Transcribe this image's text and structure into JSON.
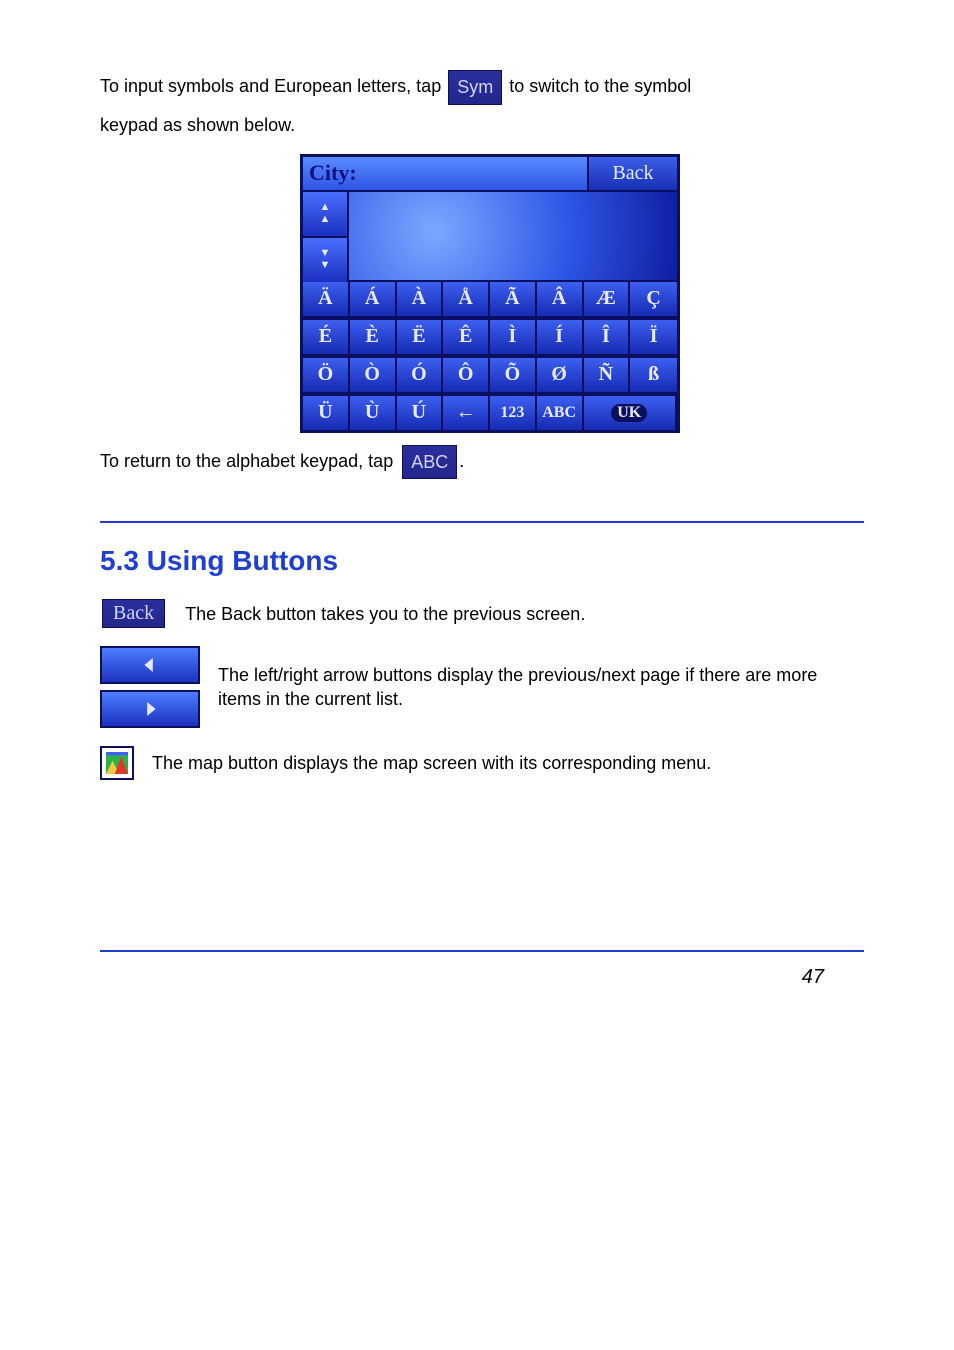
{
  "intro": {
    "p1_a": "To input symbols and European letters, tap",
    "p1_b": "to switch to the symbol",
    "p2": "keypad as shown below.",
    "sym_chip": "Sym",
    "p3_a": "To return to the alphabet keypad, tap",
    "p3_b": ".",
    "abc_chip": "ABC"
  },
  "keyboard": {
    "title": "City:",
    "back_label": "Back",
    "arrows_up_glyph": "▲▲",
    "arrows_dn_glyph": "▼▼",
    "rows": [
      [
        "Ä",
        "Á",
        "À",
        "Å",
        "Ã",
        "Â",
        "Æ",
        "Ç"
      ],
      [
        "É",
        "È",
        "Ë",
        "Ê",
        "Ì",
        "Í",
        "Î",
        "Ï"
      ],
      [
        "Ö",
        "Ò",
        "Ó",
        "Ô",
        "Õ",
        "Ø",
        "Ñ",
        "ß"
      ]
    ],
    "row4": {
      "k1": "Ü",
      "k2": "Ù",
      "k3": "Ú",
      "back_glyph": "←",
      "num": "123",
      "abc": "ABC",
      "lang": "UK"
    }
  },
  "section": {
    "heading": "5.3 Using Buttons",
    "back_row": {
      "chip": "Back",
      "text": "The Back button takes you to the previous screen."
    },
    "arrows_row": {
      "text": "The left/right arrow buttons display the previous/next page if there are more items in the current list."
    },
    "map_row": {
      "text": "The map button displays the map screen with its corresponding menu."
    }
  },
  "pagenum": "47"
}
